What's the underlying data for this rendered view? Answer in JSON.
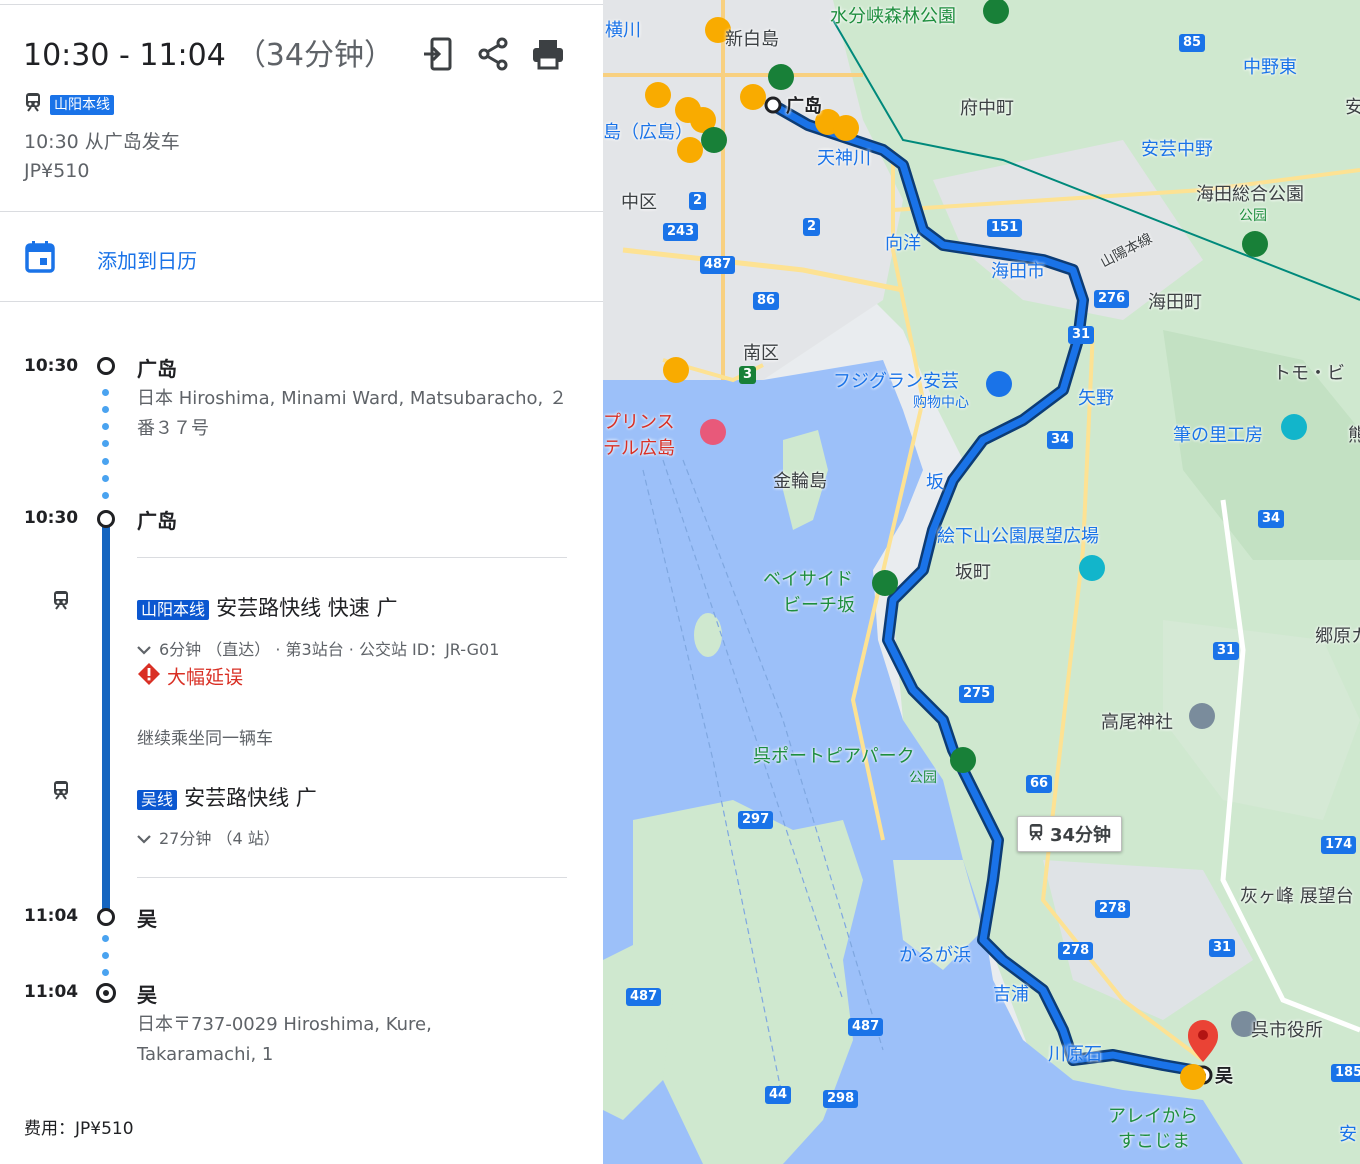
{
  "header": {
    "time_range": "10:30 - 11:04",
    "duration": "（34分钟）",
    "line_badge": "山阳本线",
    "depart_text": "10:30 从广岛发车",
    "fare": "JP¥510"
  },
  "calendar": {
    "label": "添加到日历"
  },
  "timeline": {
    "stop1": {
      "time": "10:30",
      "name": "广岛",
      "address": "日本 Hiroshima, Minami Ward, Matsubaracho, ２番３７号"
    },
    "stop2": {
      "time": "10:30",
      "name": "广岛"
    },
    "leg1": {
      "badge": "山阳本线",
      "title": "安芸路快线 快速 广",
      "details": "6分钟 （直达） · 第3站台 · 公交站 ID：JR-G01",
      "alert": "大幅延误"
    },
    "continue_text": "继续乘坐同一辆车",
    "leg2": {
      "badge": "吴线",
      "title": "安芸路快线 广",
      "details": "27分钟 （4 站）"
    },
    "stop3": {
      "time": "11:04",
      "name": "吴"
    },
    "stop4": {
      "time": "11:04",
      "name": "吴",
      "address": "日本〒737-0029 Hiroshima, Kure, Takaramachi, 1"
    }
  },
  "footer": {
    "cost": "费用：JP¥510"
  },
  "map": {
    "labels": {
      "mizubun": "水分峡森林公園",
      "shinhakushima": "新白島",
      "hiroshima": "广岛",
      "fuchumachi": "府中町",
      "nakanohigashi": "中野東",
      "akinakano": "安芸中野",
      "tenjingawa": "天神川",
      "kaitasogokoen": "海田総合公園",
      "koen": "公园",
      "sanyohonsen": "山陽本線",
      "nakaku": "中区",
      "mukainada": "向洋",
      "kaitaichi": "海田市",
      "kaitacho": "海田町",
      "minamiku": "南区",
      "fujigran": "フジグラン安芸",
      "shopping": "购物中心",
      "yano": "矢野",
      "tomo": "トモ・ビ",
      "prince1": "プリンス",
      "prince2": "テル広島",
      "fudenosato": "筆の里工房",
      "kanawajima": "金輪島",
      "saka": "坂",
      "eshita": "絵下山公園展望広場",
      "bayside1": "ベイサイド",
      "bayside2": "ビーチ坂",
      "sakacho": "坂町",
      "gohara": "郷原カ",
      "takao": "高尾神社",
      "kureport": "呉ポートピアパーク",
      "koen2": "公园",
      "haigamine": "灰ヶ峰 展望台",
      "karugahama": "かるが浜",
      "yoshiura": "吉浦",
      "kawahara": "川原石",
      "kurecity": "呉市役所",
      "kure": "吴",
      "aleykara1": "アレイから",
      "aleykara2": "すこじま",
      "hiroshimaleft": "島（広島）",
      "ryukawa": "横川",
      "an": "安",
      "ji": "熊",
      "an2": "安"
    },
    "route_time": "34分钟",
    "shields": [
      "85",
      "151",
      "2",
      "243",
      "487",
      "2",
      "86",
      "3",
      "276",
      "31",
      "34",
      "34",
      "275",
      "66",
      "297",
      "174",
      "278",
      "278",
      "31",
      "31",
      "487",
      "487",
      "44",
      "298",
      "185"
    ]
  }
}
